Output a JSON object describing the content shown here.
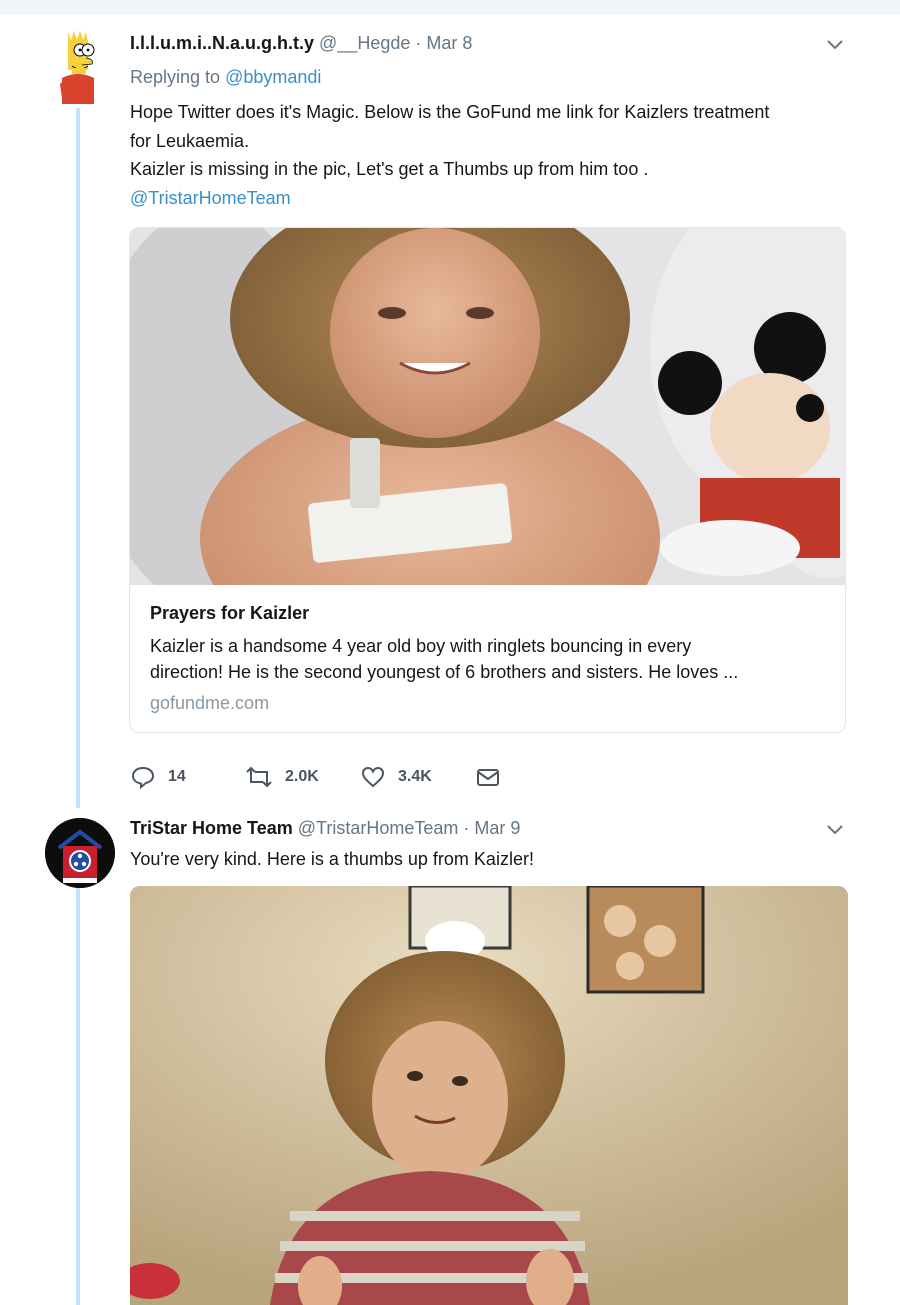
{
  "tweet1": {
    "display_name": "I.l.l.u.m.i..N.a.u.g.h.t.y",
    "handle": "@__Hegde",
    "date": "Mar 8",
    "replying_prefix": "Replying to",
    "replying_handle": "@bbymandi",
    "text_line1": "Hope Twitter does it's Magic. Below is the GoFund me link for Kaizlers treatment",
    "text_line2": "for Leukaemia.",
    "text_line3": "Kaizler is missing in the pic, Let's get a Thumbs up from him too .",
    "text_mention": "@TristarHomeTeam",
    "avatar_icon": "bart-simpson-avatar",
    "card": {
      "title": "Prayers for Kaizler",
      "description_line1": "Kaizler is a handsome 4 year old boy with ringlets bouncing in every",
      "description_line2": "direction! He is the second youngest of 6 brothers and sisters. He loves ...",
      "domain": "gofundme.com"
    },
    "actions": {
      "replies": "14",
      "retweets": "2.0K",
      "likes": "3.4K"
    }
  },
  "tweet2": {
    "display_name": "TriStar Home Team",
    "handle": "@TristarHomeTeam",
    "date": "Mar 9",
    "text": "You're very kind. Here is a thumbs up from Kaizler!",
    "avatar_icon": "tennessee-flag-house-avatar"
  },
  "colors": {
    "link": "#3a8fc8",
    "thread_line": "#c4e2f7",
    "secondary_text": "#657786"
  }
}
